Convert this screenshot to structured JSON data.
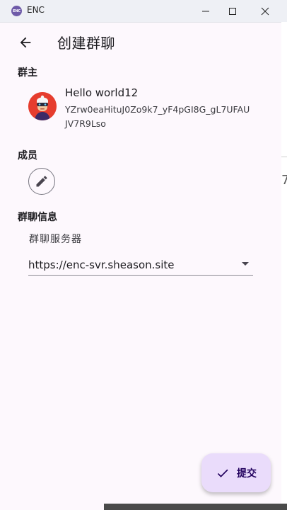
{
  "window": {
    "icon_text": "ENC",
    "title": "ENC"
  },
  "appbar": {
    "title": "创建群聊"
  },
  "owner": {
    "section_label": "群主",
    "name": "Hello world12",
    "id": "YZrw0eaHituJ0Zo9k7_yF4pGI8G_gL7UFAUJV7R9Lso"
  },
  "members": {
    "section_label": "成员"
  },
  "group_info": {
    "section_label": "群聊信息",
    "server_label": "群聊服务器",
    "server_value": "https://enc-svr.sheason.site"
  },
  "fab": {
    "label": "提交"
  },
  "background_window": {
    "glyph": "7"
  },
  "colors": {
    "accent": "#6e5aa8",
    "fab_bg": "#eadcfb",
    "avatar_bg": "#e63d2e",
    "page_bg": "#fdf8fd"
  }
}
